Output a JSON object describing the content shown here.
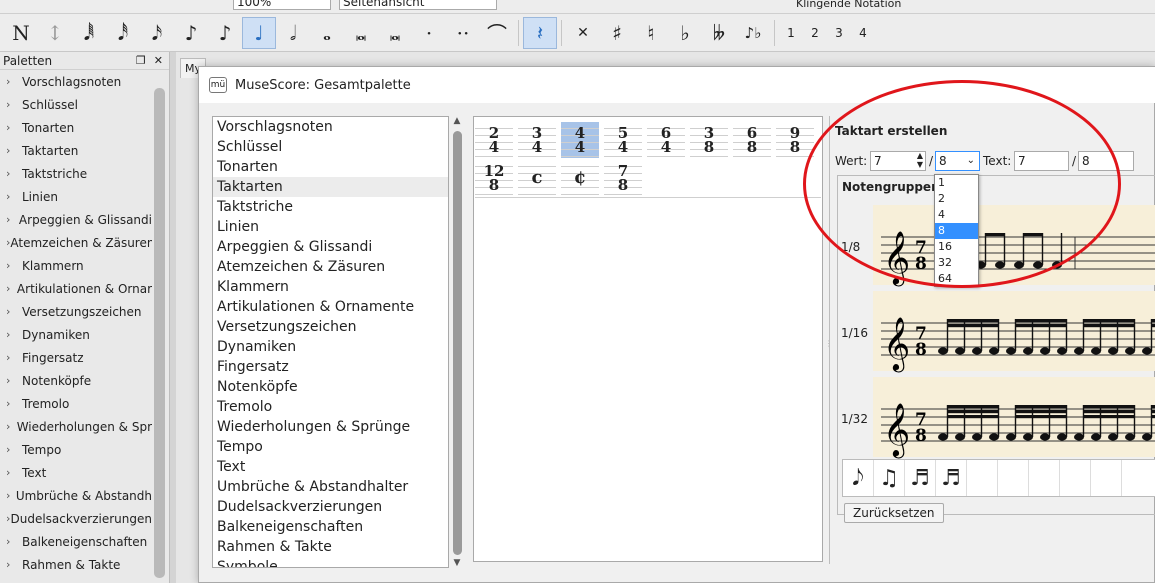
{
  "toolbar_top": {
    "zoom_value": "100%",
    "view_mode": "Seitenansicht",
    "concert_pitch": "Klingende Notation"
  },
  "toolbar_notes": {
    "items": [
      "N",
      "↕",
      "𝅘𝅥𝅱",
      "𝅘𝅥𝅰",
      "𝅘𝅥𝅯",
      "♪",
      "♪",
      "♩",
      "𝅗𝅥",
      "𝅝",
      "𝅜",
      "𝅜",
      "·",
      "··",
      "⌒",
      "𝄽",
      "✕",
      "♯",
      "♮",
      "♭",
      "𝄫",
      "♪♭",
      "1",
      "2",
      "3",
      "4"
    ]
  },
  "palettes": {
    "title": "Paletten",
    "items": [
      "Vorschlagsnoten",
      "Schlüssel",
      "Tonarten",
      "Taktarten",
      "Taktstriche",
      "Linien",
      "Arpeggien & Glissandi",
      "Atemzeichen & Zäsuren",
      "Klammern",
      "Artikulationen & Ornar",
      "Versetzungszeichen",
      "Dynamiken",
      "Fingersatz",
      "Notenköpfe",
      "Tremolo",
      "Wiederholungen & Spr",
      "Tempo",
      "Text",
      "Umbrüche & Abstandh",
      "Dudelsackverzierungen",
      "Balkeneigenschaften",
      "Rahmen & Takte"
    ]
  },
  "score_tab": "My",
  "dialog": {
    "title": "MuseScore: Gesamtpalette",
    "categories": [
      "Vorschlagsnoten",
      "Schlüssel",
      "Tonarten",
      "Taktarten",
      "Taktstriche",
      "Linien",
      "Arpeggien & Glissandi",
      "Atemzeichen & Zäsuren",
      "Klammern",
      "Artikulationen & Ornamente",
      "Versetzungszeichen",
      "Dynamiken",
      "Fingersatz",
      "Notenköpfe",
      "Tremolo",
      "Wiederholungen & Sprünge",
      "Tempo",
      "Text",
      "Umbrüche & Abstandhalter",
      "Dudelsackverzierungen",
      "Balkeneigenschaften",
      "Rahmen & Takte",
      "Symbole"
    ],
    "selected_category": "Taktarten",
    "timesigs_row1": [
      [
        "2",
        "4"
      ],
      [
        "3",
        "4"
      ],
      [
        "4",
        "4"
      ],
      [
        "5",
        "4"
      ],
      [
        "6",
        "4"
      ],
      [
        "3",
        "8"
      ],
      [
        "6",
        "8"
      ],
      [
        "9",
        "8"
      ]
    ],
    "timesigs_row2": [
      [
        "12",
        "8"
      ],
      [
        "c",
        ""
      ],
      [
        "¢",
        ""
      ],
      [
        "7",
        "8"
      ]
    ],
    "create": {
      "title": "Taktart erstellen",
      "wert_label": "Wert:",
      "numerator": "7",
      "slash": "/",
      "denominator": "8",
      "text_label": "Text:",
      "text_num": "7",
      "text_den": "8",
      "dropdown_options": [
        "1",
        "2",
        "4",
        "8",
        "16",
        "32",
        "64"
      ],
      "selected_option": "8"
    },
    "note_groups": {
      "title": "Notengruppen",
      "rows": [
        "1/8",
        "1/16",
        "1/32"
      ]
    },
    "reset_label": "Zurücksetzen"
  },
  "colors": {
    "selection": "#a7c3e8",
    "dropdown_highlight": "#3390ff",
    "annotation": "#e0161b",
    "staff_background": "#f7efd9"
  }
}
